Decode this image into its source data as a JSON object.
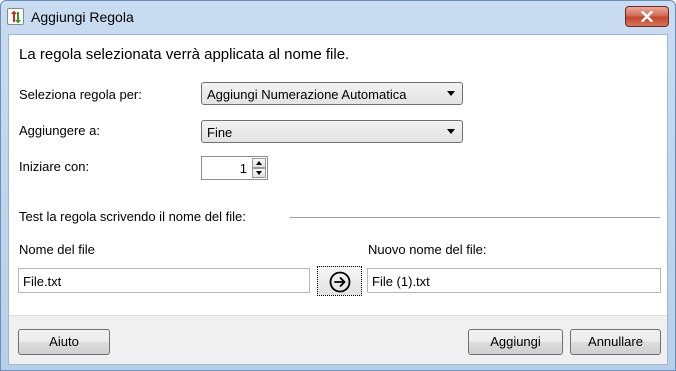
{
  "window": {
    "title": "Aggiungi Regola"
  },
  "intro_text": "La regola selezionata verrà applicata al nome file.",
  "rule_selector": {
    "label": "Seleziona regola per:",
    "value": "Aggiungi Numerazione Automatica"
  },
  "append_to": {
    "label": "Aggiungere a:",
    "value": "Fine"
  },
  "start_with": {
    "label": "Iniziare con:",
    "value": "1"
  },
  "test_group": {
    "title": "Test la regola scrivendo il nome del file:",
    "file_name_label": "Nome del file",
    "file_name_value": "File.txt",
    "new_name_label": "Nuovo nome del file:",
    "new_name_value": "File (1).txt"
  },
  "buttons": {
    "help": "Aiuto",
    "add": "Aggiungi",
    "cancel": "Annullare"
  },
  "icons": {
    "app": "rename-arrows-icon",
    "close": "close-icon",
    "go": "arrow-right-circle-icon"
  },
  "colors": {
    "close_button": "#c0452c",
    "title_bar": "#c9dcf1"
  }
}
